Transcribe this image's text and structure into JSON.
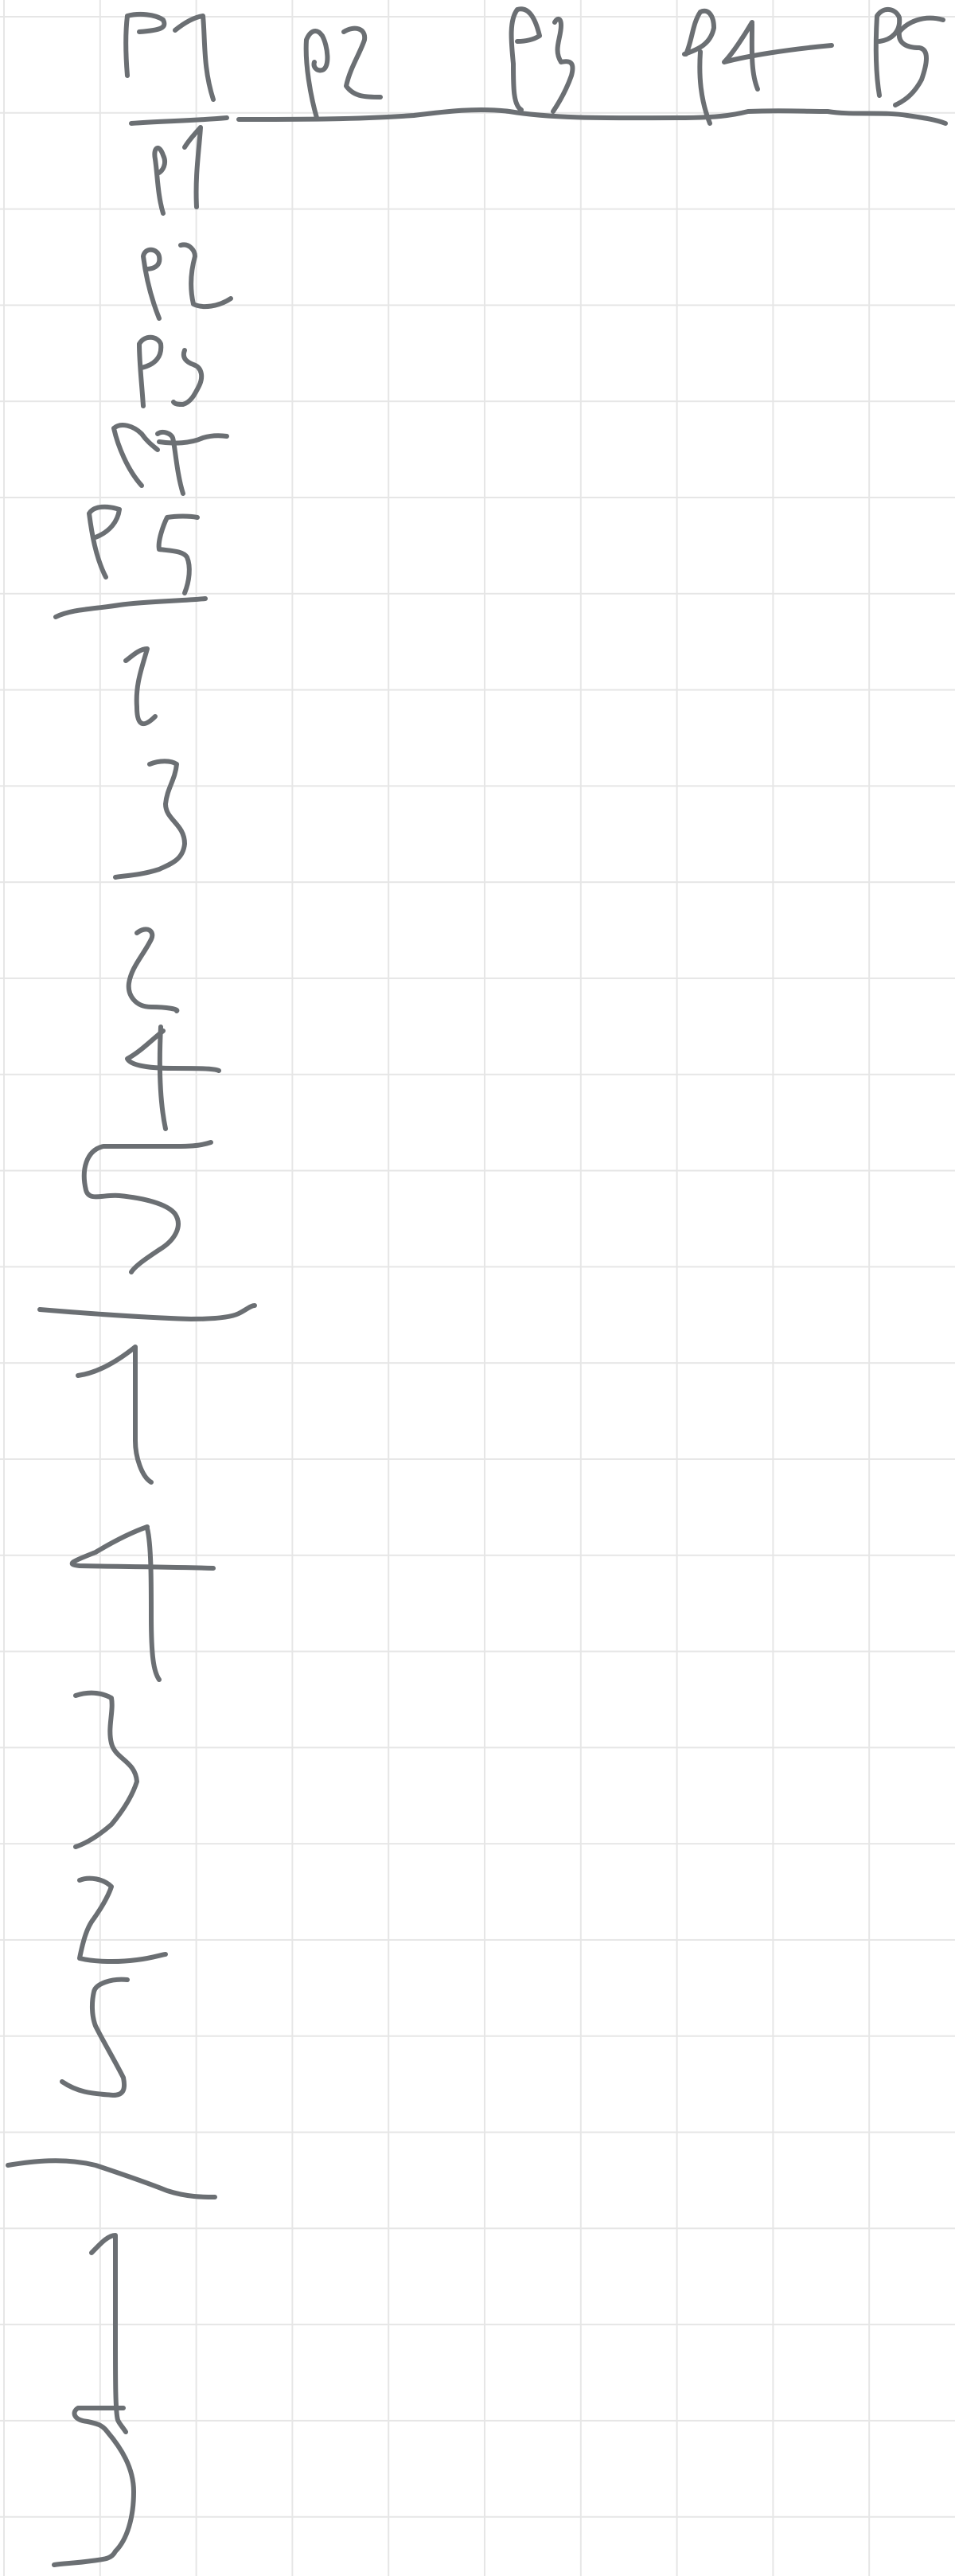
{
  "page": {
    "background_color": "#ffffff",
    "grid_color": "#e6e6e6",
    "ink_color": "#6b6f73"
  },
  "header_row": {
    "cells": [
      "P1",
      "P2",
      "P3",
      "P4",
      "P5"
    ]
  },
  "left_column": {
    "cells": [
      "P1",
      "P2",
      "P3",
      "P4",
      "P5"
    ]
  },
  "sequences": [
    {
      "values": [
        "1",
        "3",
        "2",
        "4",
        "5"
      ]
    },
    {
      "values": [
        "1",
        "4",
        "3",
        "2",
        "5"
      ]
    },
    {
      "values": [
        "1",
        "3"
      ]
    }
  ]
}
